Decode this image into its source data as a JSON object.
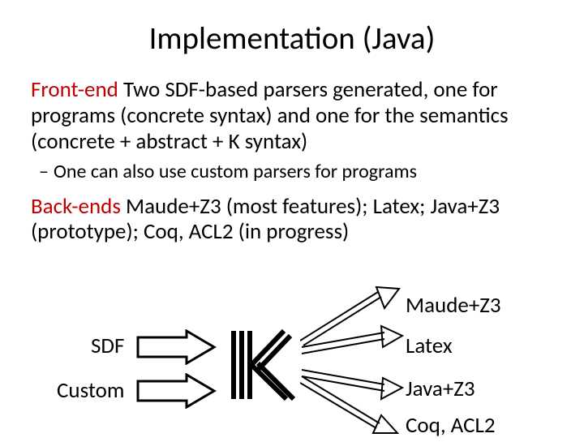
{
  "title": "Implementation (Java)",
  "frontend": {
    "label": "Front-end",
    "text": "  Two SDF-based parsers generated, one for programs (concrete syntax) and one for the semantics (concrete + abstract + K syntax)"
  },
  "frontend_sub": "One can also use custom parsers for programs",
  "backends": {
    "label": "Back-ends",
    "text": "  Maude+Z3 (most  features); Latex; Java+Z3 (prototype); Coq, ACL2 (in progress)"
  },
  "diagram": {
    "left": {
      "sdf": "SDF",
      "custom": "Custom"
    },
    "center_logo": "K",
    "right": {
      "out1": "Maude+Z3",
      "out2": "Latex",
      "out3": "Java+Z3",
      "out4": "Coq, ACL2"
    }
  }
}
